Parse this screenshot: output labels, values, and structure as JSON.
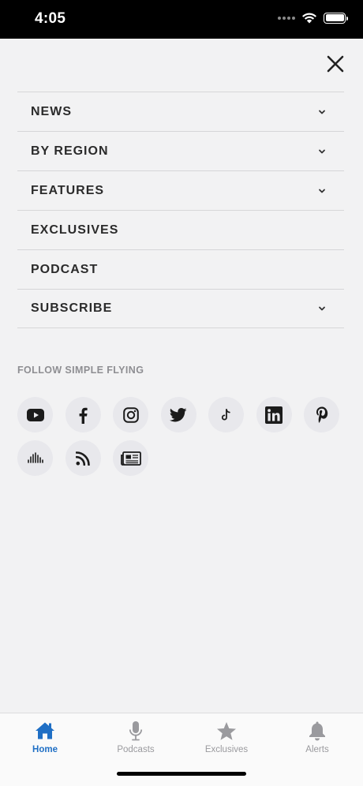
{
  "status_bar": {
    "time": "4:05"
  },
  "menu": {
    "items": [
      {
        "label": "NEWS",
        "has_submenu": true
      },
      {
        "label": "BY REGION",
        "has_submenu": true
      },
      {
        "label": "FEATURES",
        "has_submenu": true
      },
      {
        "label": "EXCLUSIVES",
        "has_submenu": false
      },
      {
        "label": "PODCAST",
        "has_submenu": false
      },
      {
        "label": "SUBSCRIBE",
        "has_submenu": true
      }
    ]
  },
  "follow": {
    "title": "FOLLOW SIMPLE FLYING",
    "networks": [
      "youtube-icon",
      "facebook-icon",
      "instagram-icon",
      "twitter-icon",
      "tiktok-icon",
      "linkedin-icon",
      "pinterest-icon",
      "anchor-podcast-icon",
      "rss-icon",
      "newspaper-icon"
    ]
  },
  "tabs": [
    {
      "label": "Home",
      "icon": "home-icon",
      "active": true
    },
    {
      "label": "Podcasts",
      "icon": "microphone-icon",
      "active": false
    },
    {
      "label": "Exclusives",
      "icon": "star-icon",
      "active": false
    },
    {
      "label": "Alerts",
      "icon": "bell-icon",
      "active": false
    }
  ],
  "colors": {
    "accent": "#1f6fc5",
    "background": "#f2f2f3",
    "text": "#2b2b2b",
    "muted": "#8e8e92"
  }
}
